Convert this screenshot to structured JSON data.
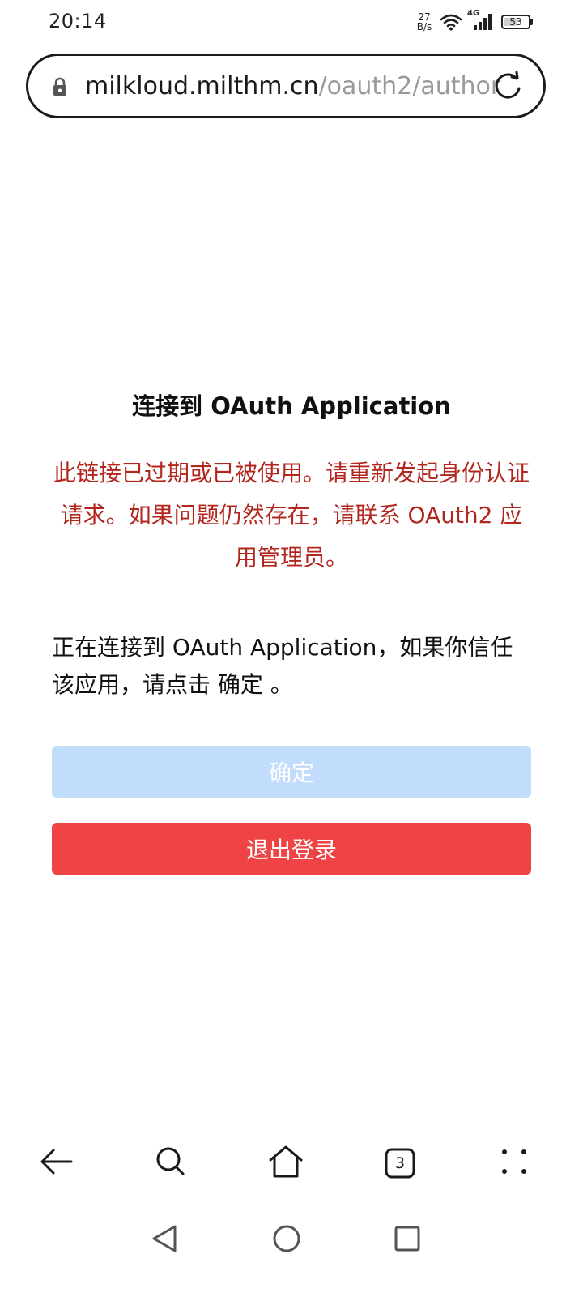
{
  "status_bar": {
    "time": "20:14",
    "net_speed_value": "27",
    "net_speed_unit": "B/s",
    "network_type": "4G",
    "battery_level": "53",
    "battery_fraction": 0.53
  },
  "address_bar": {
    "host": "milkloud.milthm.cn",
    "path": "/oauth2/author"
  },
  "main": {
    "heading": "连接到 OAuth Application",
    "error_message": "此链接已过期或已被使用。请重新发起身份认证请求。如果问题仍然存在，请联系 OAuth2 应用管理员。",
    "connect_message": "正在连接到 OAuth Application，如果你信任该应用，请点击 确定 。",
    "confirm_label": "确定",
    "logout_label": "退出登录"
  },
  "toolbar": {
    "tabs_count": "3"
  },
  "colors": {
    "error_text": "#b3261e",
    "confirm_button_disabled": "#c2dcfc",
    "logout_button": "#ef4345"
  }
}
